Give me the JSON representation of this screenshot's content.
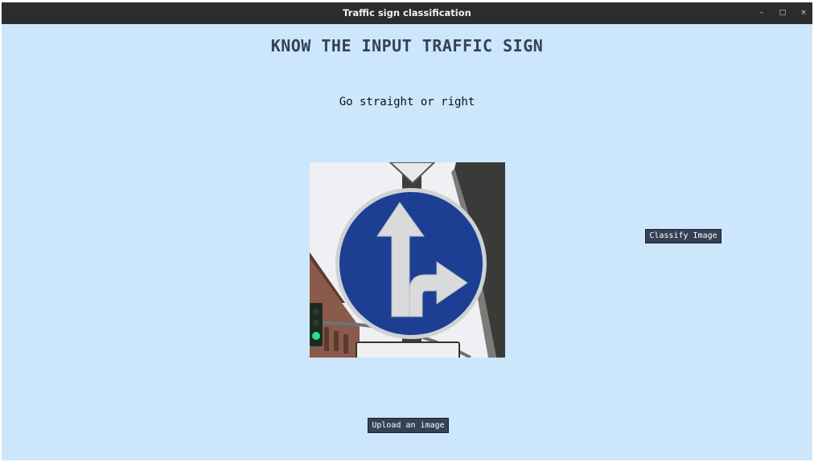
{
  "window": {
    "title": "Traffic sign classification",
    "minimize_label": "–",
    "maximize_label": "□",
    "close_label": "×"
  },
  "main": {
    "heading": "KNOW THE INPUT TRAFFIC SIGN",
    "result_label": "Go straight or right",
    "classify_button": "Classify Image",
    "upload_button": "Upload an image"
  },
  "colors": {
    "background": "#cce6fb",
    "titlebar": "#2c2c2c",
    "button": "#364156",
    "sign_blue": "#1c3f94"
  },
  "image": {
    "description_icon": "traffic-sign-straight-or-right"
  }
}
